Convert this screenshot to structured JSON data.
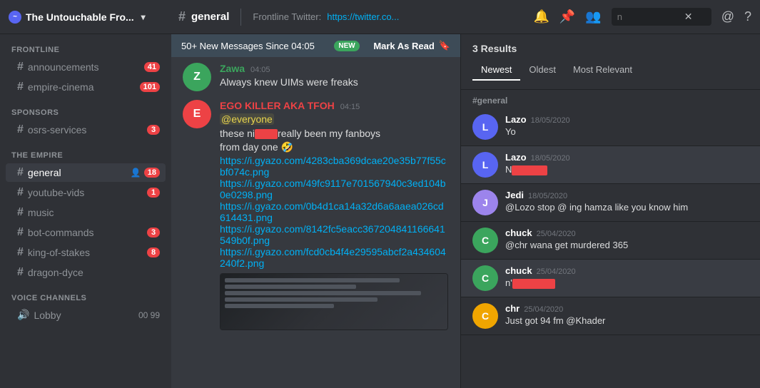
{
  "topbar": {
    "server_icon": "~",
    "server_name": "The Untouchable Fro...",
    "channel_name": "general",
    "topic_prefix": "Frontline Twitter: ",
    "topic_link_text": "https://twitter.co...",
    "search_placeholder": "n",
    "search_clear": "✕"
  },
  "sidebar": {
    "sections": [
      {
        "label": "FRONTLINE",
        "channels": [
          {
            "name": "announcements",
            "badge": "41",
            "type": "text"
          },
          {
            "name": "empire-cinema",
            "badge": "101",
            "type": "text"
          }
        ]
      },
      {
        "label": "SPONSORS",
        "channels": [
          {
            "name": "osrs-services",
            "badge": "3",
            "type": "text"
          }
        ]
      },
      {
        "label": "THE EMPIRE",
        "channels": [
          {
            "name": "general",
            "badge": "18",
            "active": true,
            "type": "text",
            "member_icon": true
          },
          {
            "name": "youtube-vids",
            "badge": "1",
            "type": "text"
          },
          {
            "name": "music",
            "badge": "",
            "type": "text"
          },
          {
            "name": "bot-commands",
            "badge": "3",
            "type": "text"
          },
          {
            "name": "king-of-stakes",
            "badge": "8",
            "type": "text"
          },
          {
            "name": "dragon-dyce",
            "badge": "",
            "type": "text"
          }
        ]
      },
      {
        "label": "VOICE CHANNELS",
        "voice_channels": [
          {
            "name": "Lobby",
            "count_current": "00",
            "count_max": "99"
          }
        ]
      }
    ]
  },
  "new_messages_bar": {
    "text": "50+ New Messages Since 04:05",
    "action": "Mark As Read",
    "badge": "NEW"
  },
  "messages": [
    {
      "time": "04:05",
      "author": "Zawa",
      "author_color": "green",
      "text": "Always knew UIMs were freaks",
      "avatar_letter": "Z",
      "avatar_color": "#3ba55d"
    },
    {
      "time": "04:15",
      "author": "EGO KILLER AKA TFOH",
      "author_color": "red",
      "mention": "@everyone",
      "text_before": "these ni",
      "text_redacted": true,
      "text_after": "really been my fanboys\nfrom day one 🤣",
      "links": [
        "https://i.gyazo.com/4283cba369dcae20e35b77f55cbf074c.png",
        "https://i.gyazo.com/49fc9117e701567940c3ed104b0e0298.png",
        "https://i.gyazo.com/0b4d1ca14a32d6a6aaea026cd614431.png",
        "https://i.gyazo.com/8142fc5eacc367204841166641549b0f.png",
        "https://i.gyazo.com/fcd0cb4f4e29595abcf2a434604240f2.png"
      ],
      "has_screenshot": true,
      "avatar_letter": "E",
      "avatar_color": "#ed4245"
    }
  ],
  "search_panel": {
    "results_count": "3 Results",
    "tabs": [
      "Newest",
      "Oldest",
      "Most Relevant"
    ],
    "active_tab": "Newest",
    "channel_label": "#general",
    "results": [
      {
        "author": "Lazo",
        "time": "18/05/2020",
        "text": "Yo",
        "avatar_letter": "L",
        "avatar_color": "#5865f2"
      },
      {
        "author": "Lazo",
        "time": "18/05/2020",
        "text_redacted": true,
        "avatar_letter": "L",
        "avatar_color": "#5865f2"
      },
      {
        "author": "Jedi",
        "time": "18/05/2020",
        "text": "@Lazo stop @ ing hamza like you know him",
        "avatar_letter": "J",
        "avatar_color": "#9c84ec"
      },
      {
        "author": "chuck",
        "time": "25/04/2020",
        "text": "@chr wana get murdered 365",
        "avatar_letter": "C",
        "avatar_color": "#3ba55d"
      },
      {
        "author": "chuck",
        "time": "25/04/2020",
        "text_redacted": true,
        "avatar_letter": "C",
        "avatar_color": "#3ba55d",
        "highlighted": true
      },
      {
        "author": "chr",
        "time": "25/04/2020",
        "text": "Just got 94 fm @Khader",
        "avatar_letter": "C",
        "avatar_color": "#f0a500"
      }
    ]
  }
}
